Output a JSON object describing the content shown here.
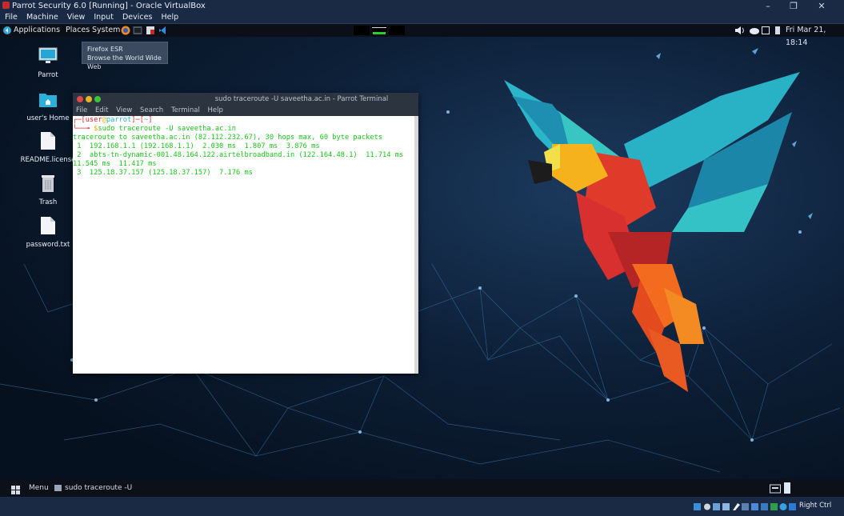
{
  "host": {
    "window_title": "Parrot Security 6.0 [Running] - Oracle VirtualBox",
    "menu": [
      "File",
      "Machine",
      "View",
      "Input",
      "Devices",
      "Help"
    ],
    "status_right": "Right Ctrl",
    "controls": {
      "minimize": "–",
      "restore": "❐",
      "close": "✕"
    }
  },
  "top_panel": {
    "menus": [
      "Applications",
      "Places",
      "System"
    ],
    "clock": "Fri Mar 21, 18:14"
  },
  "tooltip": {
    "title": "Firefox ESR",
    "subtitle": "Browse the World Wide Web"
  },
  "desktop_icons": [
    {
      "label": "Parrot",
      "icon": "monitor-icon"
    },
    {
      "label": "user's Home",
      "icon": "home-folder-icon"
    },
    {
      "label": "README.license",
      "icon": "file-icon"
    },
    {
      "label": "Trash",
      "icon": "trash-icon"
    },
    {
      "label": "password.txt",
      "icon": "file-icon"
    }
  ],
  "terminal": {
    "title": "sudo traceroute -U saveetha.ac.in - Parrot Terminal",
    "menu": [
      "File",
      "Edit",
      "View",
      "Search",
      "Terminal",
      "Help"
    ],
    "prompt_user": "user",
    "prompt_at": "@",
    "prompt_host": "parrot",
    "prompt_dir": "~",
    "command": "sudo traceroute -U saveetha.ac.in",
    "output": [
      "traceroute to saveetha.ac.in (82.112.232.67), 30 hops max, 60 byte packets",
      " 1  192.168.1.1 (192.168.1.1)  2.030 ms  1.807 ms  3.876 ms",
      " 2  abts-tn-dynamic-001.48.164.122.airtelbroadband.in (122.164.48.1)  11.714 ms",
      "11.545 ms  11.417 ms",
      " 3  125.18.37.157 (125.18.37.157)  7.176 ms"
    ]
  },
  "bottom_panel": {
    "menu_label": "Menu",
    "task_label": "sudo traceroute -U sa..."
  },
  "colors": {
    "terminal_text": "#19c819",
    "prompt_red": "#e0262a",
    "prompt_cyan": "#22b5d8",
    "prompt_yellow": "#e0b400"
  }
}
